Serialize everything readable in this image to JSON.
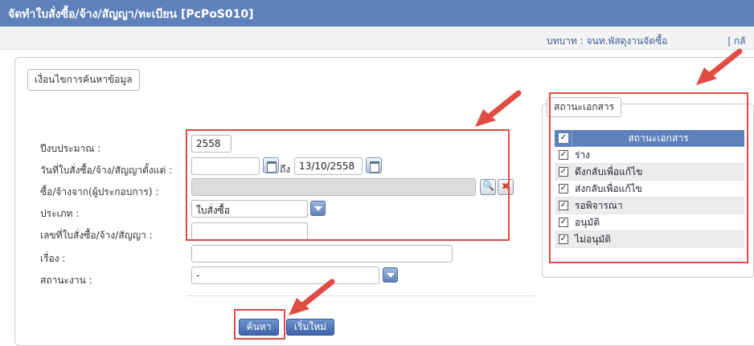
{
  "header": {
    "title": "จัดทำใบสั่งซื้อ/จ้าง/สัญญา/ทะเบียน [PcPoS010]",
    "role": "บทบาท : จนท.พัสดุงานจัดซื้อ",
    "separator_text": "| กลั"
  },
  "search": {
    "legend": "เงื่อนไขการค้นหาข้อมูล",
    "fields": {
      "fiscal_year": {
        "label": "ปีงบประมาณ :",
        "value": "2558"
      },
      "po_date": {
        "label": "วันที่ใบสั่งซื้อ/จ้าง/สัญญาตั้งแต่ :",
        "from_value": "",
        "to_label": "ถึง",
        "to_value": "13/10/2558"
      },
      "vendor": {
        "label": "ซื้อ/จ้างจาก(ผู้ประกอบการ) :",
        "value": ""
      },
      "type": {
        "label": "ประเภท :",
        "value": "ใบสั่งซื้อ"
      },
      "po_number": {
        "label": "เลขที่ใบสั่งซื้อ/จ้าง/สัญญา :",
        "value": ""
      },
      "subject": {
        "label": "เรื่อง :",
        "value": ""
      },
      "work_status": {
        "label": "สถานะงาน :",
        "value": "-"
      }
    },
    "buttons": {
      "search": "ค้นหา",
      "reset": "เริ่มใหม่"
    }
  },
  "doc_status": {
    "legend": "สถานะเอกสาร",
    "column_header": "สถานะเอกสาร",
    "items": [
      {
        "label": "ร่าง",
        "checked": true
      },
      {
        "label": "ดึงกลับเพื่อแก้ไข",
        "checked": true
      },
      {
        "label": "ส่งกลับเพื่อแก้ไข",
        "checked": true
      },
      {
        "label": "รอพิจารณา",
        "checked": true
      },
      {
        "label": "อนุมัติ",
        "checked": true
      },
      {
        "label": "ไม่อนุมัติ",
        "checked": true
      }
    ]
  },
  "colors": {
    "header_blue": "#5e80bb",
    "highlight_red": "#e04b44"
  }
}
